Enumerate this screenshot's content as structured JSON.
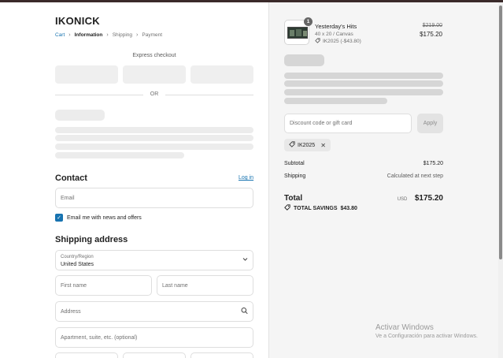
{
  "brand": "IKONICK",
  "breadcrumb": {
    "cart": "Cart",
    "information": "Information",
    "shipping": "Shipping",
    "payment": "Payment"
  },
  "express": {
    "label": "Express checkout",
    "or": "OR"
  },
  "contact": {
    "title": "Contact",
    "login": "Log in",
    "email_placeholder": "Email",
    "newsletter_label": "Email me with news and offers",
    "newsletter_checked": true
  },
  "shipping_address": {
    "title": "Shipping address",
    "country_label": "Country/Region",
    "country_value": "United States",
    "first_name": "First name",
    "last_name": "Last name",
    "address": "Address",
    "apartment": "Apartment, suite, etc. (optional)"
  },
  "summary": {
    "product": {
      "quantity": "1",
      "name": "Yesterday's Hits",
      "variant": "40 x 20 / Canvas",
      "discount": "IK2025 (-$43.80)",
      "price_original": "$219.00",
      "price_final": "$175.20"
    },
    "discount_placeholder": "Discount code or gift card",
    "apply": "Apply",
    "applied_code": "IK2025",
    "subtotal_label": "Subtotal",
    "subtotal_value": "$175.20",
    "shipping_label": "Shipping",
    "shipping_value": "Calculated at next step",
    "total_label": "Total",
    "total_currency": "USD",
    "total_value": "$175.20",
    "savings_label": "TOTAL SAVINGS",
    "savings_value": "$43.80"
  },
  "watermark": {
    "line1": "Activar Windows",
    "line2": "Ve a Configuración para activar Windows."
  },
  "colors": {
    "link": "#1773b0",
    "checkbox": "#1773b0",
    "skeleton": "#ececec",
    "summary_bg": "#f5f5f5"
  }
}
